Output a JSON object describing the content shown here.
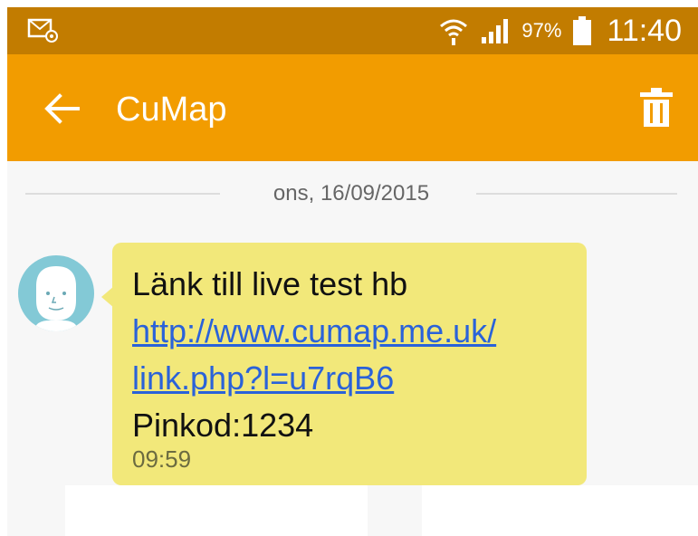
{
  "status_bar": {
    "battery_percent": "97%",
    "time": "11:40",
    "icons": [
      "email-notification-icon",
      "wifi-icon",
      "signal-icon",
      "battery-icon"
    ]
  },
  "action_bar": {
    "title": "CuMap",
    "icons": [
      "back-arrow-icon",
      "trash-icon"
    ]
  },
  "conversation": {
    "date": "ons, 16/09/2015",
    "message": {
      "line1": "Länk till live test hb",
      "link_line1": "http://www.cumap.me.uk/",
      "link_line2": "link.php?l=u7rqB6",
      "line3": "Pinkod:1234",
      "time": "09:59"
    }
  },
  "colors": {
    "status_bar": "#c27c00",
    "action_bar": "#f29c00",
    "bubble": "#f2e87a",
    "link": "#2a62d9",
    "avatar": "#83c9d6"
  }
}
